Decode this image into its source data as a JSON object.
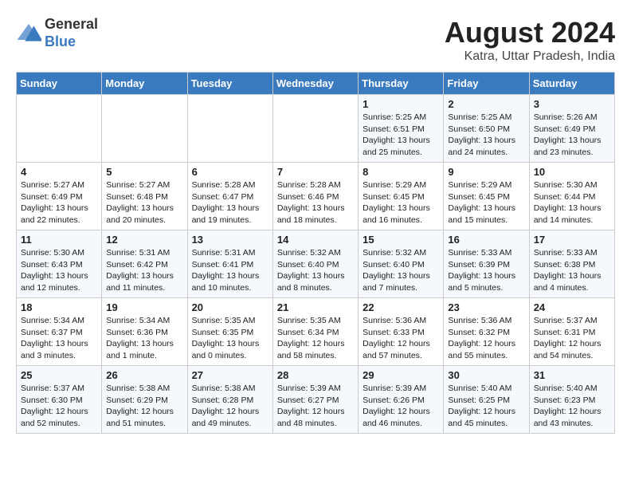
{
  "logo": {
    "general": "General",
    "blue": "Blue"
  },
  "title": "August 2024",
  "location": "Katra, Uttar Pradesh, India",
  "days_of_week": [
    "Sunday",
    "Monday",
    "Tuesday",
    "Wednesday",
    "Thursday",
    "Friday",
    "Saturday"
  ],
  "weeks": [
    [
      {
        "day": "",
        "info": ""
      },
      {
        "day": "",
        "info": ""
      },
      {
        "day": "",
        "info": ""
      },
      {
        "day": "",
        "info": ""
      },
      {
        "day": "1",
        "info": "Sunrise: 5:25 AM\nSunset: 6:51 PM\nDaylight: 13 hours\nand 25 minutes."
      },
      {
        "day": "2",
        "info": "Sunrise: 5:25 AM\nSunset: 6:50 PM\nDaylight: 13 hours\nand 24 minutes."
      },
      {
        "day": "3",
        "info": "Sunrise: 5:26 AM\nSunset: 6:49 PM\nDaylight: 13 hours\nand 23 minutes."
      }
    ],
    [
      {
        "day": "4",
        "info": "Sunrise: 5:27 AM\nSunset: 6:49 PM\nDaylight: 13 hours\nand 22 minutes."
      },
      {
        "day": "5",
        "info": "Sunrise: 5:27 AM\nSunset: 6:48 PM\nDaylight: 13 hours\nand 20 minutes."
      },
      {
        "day": "6",
        "info": "Sunrise: 5:28 AM\nSunset: 6:47 PM\nDaylight: 13 hours\nand 19 minutes."
      },
      {
        "day": "7",
        "info": "Sunrise: 5:28 AM\nSunset: 6:46 PM\nDaylight: 13 hours\nand 18 minutes."
      },
      {
        "day": "8",
        "info": "Sunrise: 5:29 AM\nSunset: 6:45 PM\nDaylight: 13 hours\nand 16 minutes."
      },
      {
        "day": "9",
        "info": "Sunrise: 5:29 AM\nSunset: 6:45 PM\nDaylight: 13 hours\nand 15 minutes."
      },
      {
        "day": "10",
        "info": "Sunrise: 5:30 AM\nSunset: 6:44 PM\nDaylight: 13 hours\nand 14 minutes."
      }
    ],
    [
      {
        "day": "11",
        "info": "Sunrise: 5:30 AM\nSunset: 6:43 PM\nDaylight: 13 hours\nand 12 minutes."
      },
      {
        "day": "12",
        "info": "Sunrise: 5:31 AM\nSunset: 6:42 PM\nDaylight: 13 hours\nand 11 minutes."
      },
      {
        "day": "13",
        "info": "Sunrise: 5:31 AM\nSunset: 6:41 PM\nDaylight: 13 hours\nand 10 minutes."
      },
      {
        "day": "14",
        "info": "Sunrise: 5:32 AM\nSunset: 6:40 PM\nDaylight: 13 hours\nand 8 minutes."
      },
      {
        "day": "15",
        "info": "Sunrise: 5:32 AM\nSunset: 6:40 PM\nDaylight: 13 hours\nand 7 minutes."
      },
      {
        "day": "16",
        "info": "Sunrise: 5:33 AM\nSunset: 6:39 PM\nDaylight: 13 hours\nand 5 minutes."
      },
      {
        "day": "17",
        "info": "Sunrise: 5:33 AM\nSunset: 6:38 PM\nDaylight: 13 hours\nand 4 minutes."
      }
    ],
    [
      {
        "day": "18",
        "info": "Sunrise: 5:34 AM\nSunset: 6:37 PM\nDaylight: 13 hours\nand 3 minutes."
      },
      {
        "day": "19",
        "info": "Sunrise: 5:34 AM\nSunset: 6:36 PM\nDaylight: 13 hours\nand 1 minute."
      },
      {
        "day": "20",
        "info": "Sunrise: 5:35 AM\nSunset: 6:35 PM\nDaylight: 13 hours\nand 0 minutes."
      },
      {
        "day": "21",
        "info": "Sunrise: 5:35 AM\nSunset: 6:34 PM\nDaylight: 12 hours\nand 58 minutes."
      },
      {
        "day": "22",
        "info": "Sunrise: 5:36 AM\nSunset: 6:33 PM\nDaylight: 12 hours\nand 57 minutes."
      },
      {
        "day": "23",
        "info": "Sunrise: 5:36 AM\nSunset: 6:32 PM\nDaylight: 12 hours\nand 55 minutes."
      },
      {
        "day": "24",
        "info": "Sunrise: 5:37 AM\nSunset: 6:31 PM\nDaylight: 12 hours\nand 54 minutes."
      }
    ],
    [
      {
        "day": "25",
        "info": "Sunrise: 5:37 AM\nSunset: 6:30 PM\nDaylight: 12 hours\nand 52 minutes."
      },
      {
        "day": "26",
        "info": "Sunrise: 5:38 AM\nSunset: 6:29 PM\nDaylight: 12 hours\nand 51 minutes."
      },
      {
        "day": "27",
        "info": "Sunrise: 5:38 AM\nSunset: 6:28 PM\nDaylight: 12 hours\nand 49 minutes."
      },
      {
        "day": "28",
        "info": "Sunrise: 5:39 AM\nSunset: 6:27 PM\nDaylight: 12 hours\nand 48 minutes."
      },
      {
        "day": "29",
        "info": "Sunrise: 5:39 AM\nSunset: 6:26 PM\nDaylight: 12 hours\nand 46 minutes."
      },
      {
        "day": "30",
        "info": "Sunrise: 5:40 AM\nSunset: 6:25 PM\nDaylight: 12 hours\nand 45 minutes."
      },
      {
        "day": "31",
        "info": "Sunrise: 5:40 AM\nSunset: 6:23 PM\nDaylight: 12 hours\nand 43 minutes."
      }
    ]
  ]
}
